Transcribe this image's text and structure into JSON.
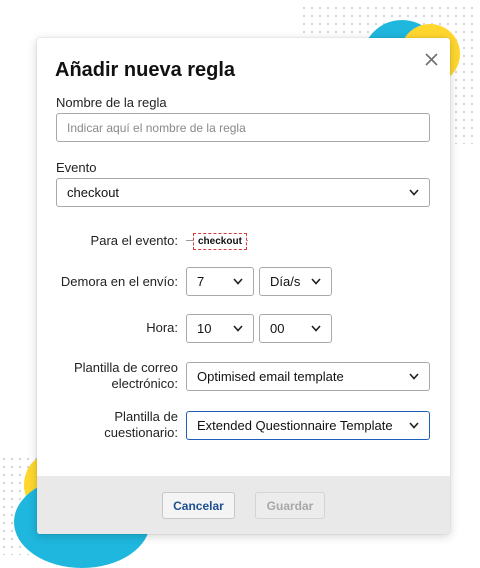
{
  "modal": {
    "title": "Añadir nueva regla",
    "rule_name": {
      "label": "Nombre de la regla",
      "value": "",
      "placeholder": "Indicar aquí el nombre de la regla"
    },
    "event": {
      "label": "Evento",
      "value": "checkout"
    },
    "for_event": {
      "label": "Para el evento:",
      "tag": "checkout"
    },
    "delay": {
      "label": "Demora en el envío:",
      "amount": "7",
      "unit": "Día/s"
    },
    "time": {
      "label": "Hora:",
      "hour": "10",
      "minute": "00"
    },
    "email_template": {
      "label_line1": "Plantilla de correo",
      "label_line2": "electrónico:",
      "value": "Optimised email template"
    },
    "questionnaire_template": {
      "label_line1": "Plantilla de",
      "label_line2": "cuestionario:",
      "value": "Extended Questionnaire Template"
    },
    "buttons": {
      "cancel": "Cancelar",
      "save": "Guardar"
    }
  },
  "colors": {
    "accent": "#1c5fb8",
    "cancel_text": "#1d4f91",
    "disabled_text": "#a7a7a7",
    "tag_border": "#d93b3b",
    "decor_cyan": "#1fb7de",
    "decor_yellow": "#ffd72e"
  },
  "icons": {
    "close": "close-icon",
    "select_arrow": "chevron-down-icon"
  }
}
